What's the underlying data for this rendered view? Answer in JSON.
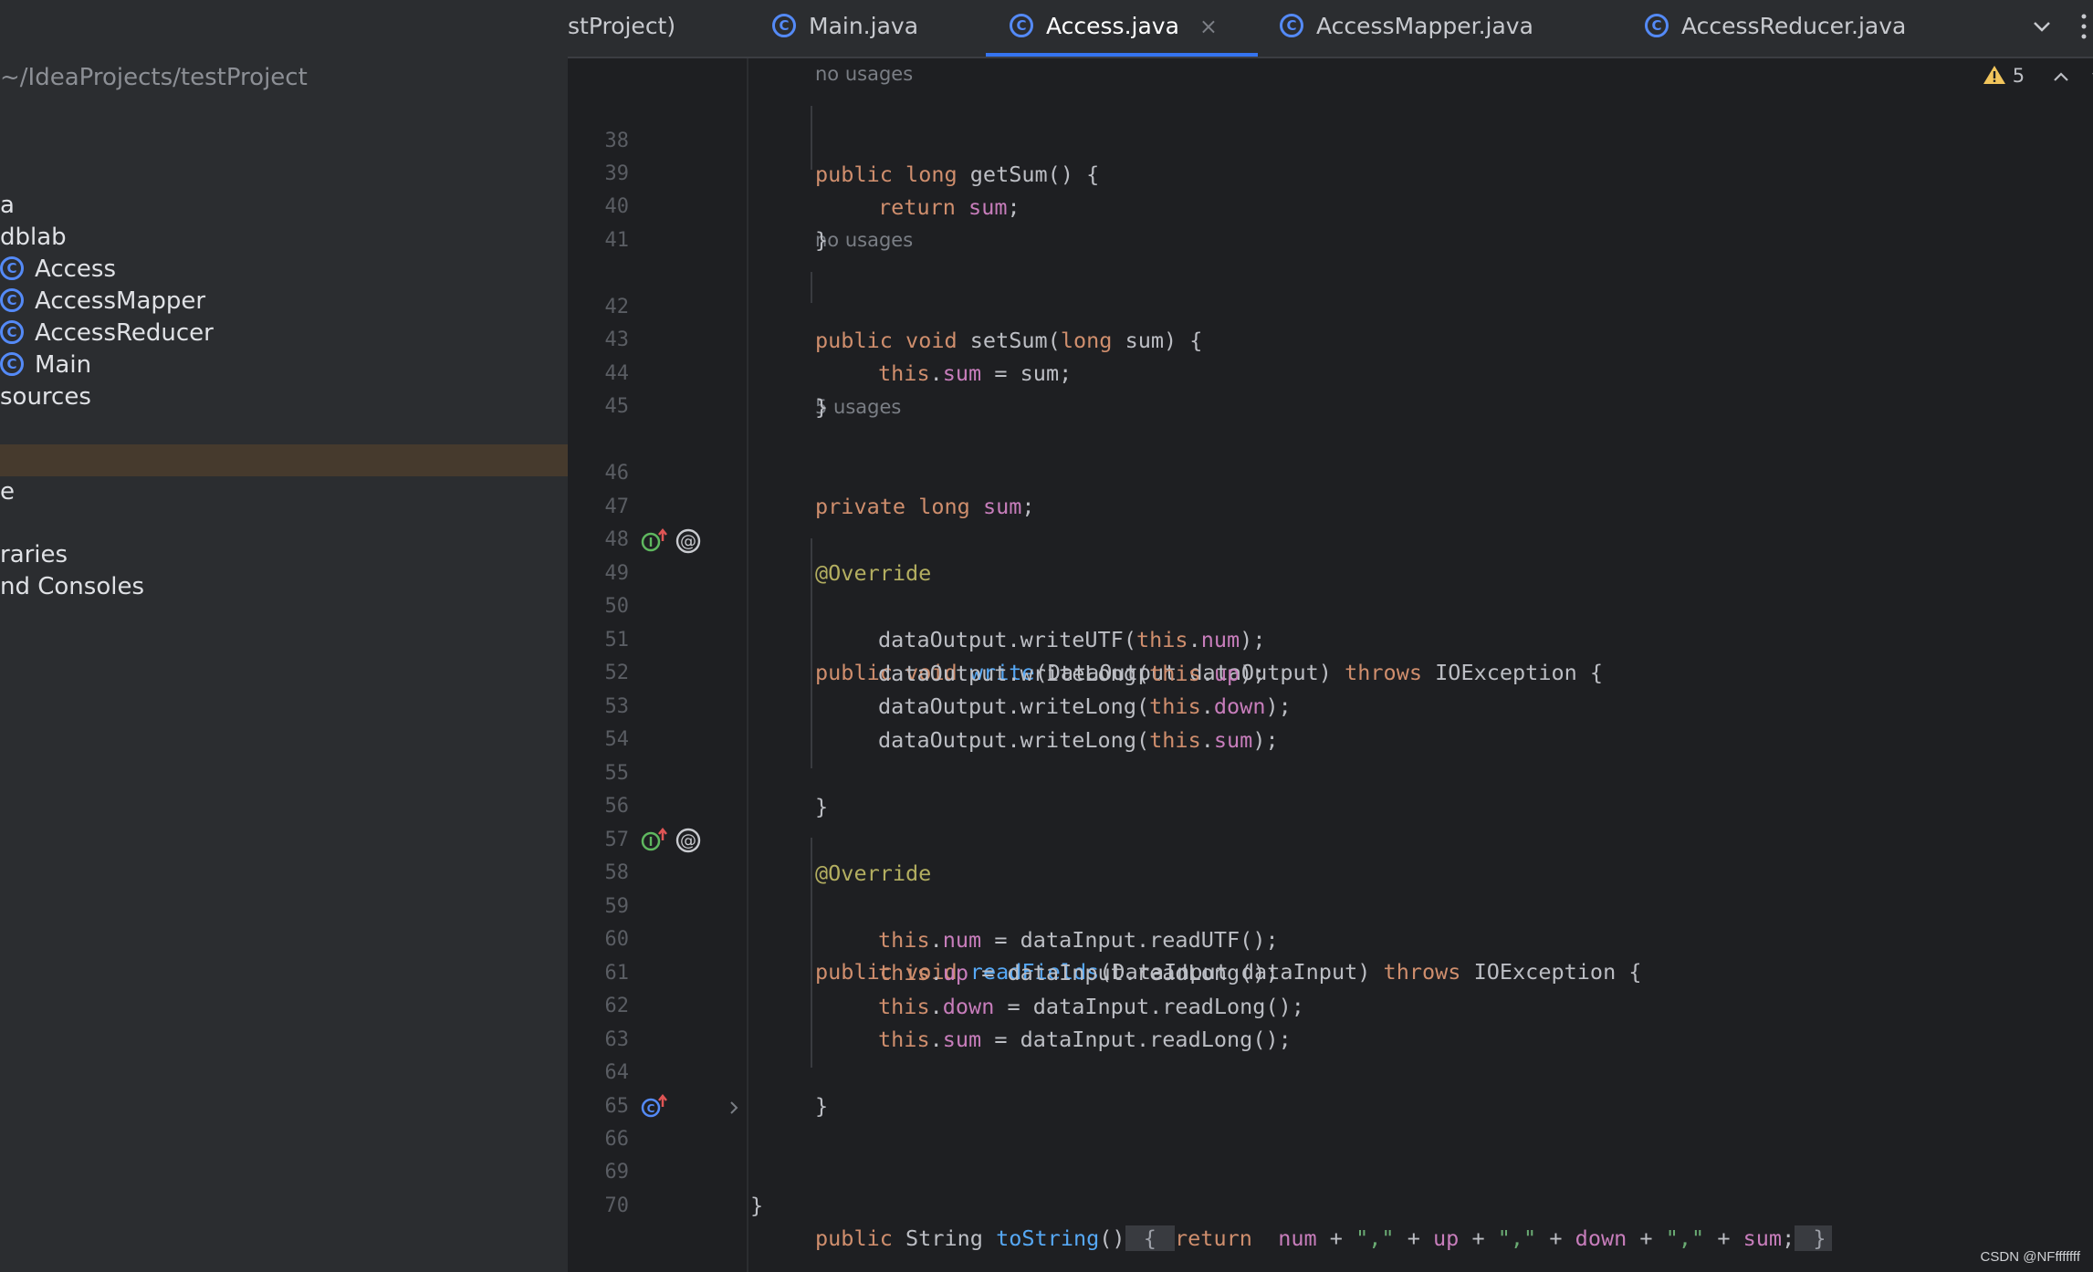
{
  "sidebar": {
    "project_path": "~/IdeaProjects/testProject",
    "items": [
      {
        "label": "a",
        "icon": ""
      },
      {
        "label": "dblab",
        "icon": ""
      },
      {
        "label": "Access",
        "icon": "class-icon"
      },
      {
        "label": "AccessMapper",
        "icon": "class-icon"
      },
      {
        "label": "AccessReducer",
        "icon": "class-icon"
      },
      {
        "label": "Main",
        "icon": "class-icon"
      },
      {
        "label": "sources",
        "icon": ""
      },
      {
        "label": "e",
        "icon": ""
      },
      {
        "label": "raries",
        "icon": ""
      },
      {
        "label": "nd Consoles",
        "icon": ""
      }
    ],
    "class_icon_glyph": "C"
  },
  "tabs": {
    "items": [
      {
        "label": "stProject)"
      },
      {
        "label": "Main.java"
      },
      {
        "label": "Access.java",
        "active": true
      },
      {
        "label": "AccessMapper.java"
      },
      {
        "label": "AccessReducer.java"
      }
    ],
    "close_glyph": "×"
  },
  "editor": {
    "warnings_count": "5",
    "hints": {
      "h38": "no usages",
      "h42": "no usages",
      "h46": "5 usages"
    },
    "line_numbers": {
      "l38": "38",
      "l39": "39",
      "l40": "40",
      "l41": "41",
      "l42": "42",
      "l43": "43",
      "l44": "44",
      "l45": "45",
      "l46": "46",
      "l47": "47",
      "l48": "48",
      "l49": "49",
      "l50": "50",
      "l51": "51",
      "l52": "52",
      "l53": "53",
      "l54": "54",
      "l55": "55",
      "l56": "56",
      "l57": "57",
      "l58": "58",
      "l59": "59",
      "l60": "60",
      "l61": "61",
      "l62": "62",
      "l63": "63",
      "l64": "64",
      "l65": "65",
      "l66": "66",
      "l69": "69",
      "l70": "70"
    },
    "code": {
      "c38": [
        "public",
        " ",
        "long",
        " getSum() {"
      ],
      "c39": [
        "return",
        " ",
        "sum",
        ";"
      ],
      "c40": "}",
      "c42": [
        "public",
        " ",
        "void",
        " setSum(",
        "long",
        " sum) {"
      ],
      "c43": [
        "this",
        ".",
        "sum",
        " = sum;"
      ],
      "c44": "}",
      "c46": [
        "private",
        " ",
        "long",
        " ",
        "sum",
        ";"
      ],
      "c48": "@Override",
      "c49": [
        "public",
        " ",
        "void",
        " ",
        "write",
        "(DataOutput dataOutput) ",
        "throws",
        " IOException {"
      ],
      "c50": [
        "dataOutput.writeUTF(",
        "this",
        ".",
        "num",
        ");"
      ],
      "c51": [
        "dataOutput.writeLong(",
        "this",
        ".",
        "up",
        ");"
      ],
      "c52": [
        "dataOutput.writeLong(",
        "this",
        ".",
        "down",
        ");"
      ],
      "c53": [
        "dataOutput.writeLong(",
        "this",
        ".",
        "sum",
        ");"
      ],
      "c55": "}",
      "c57": "@Override",
      "c58": [
        "public",
        " ",
        "void",
        " ",
        "readFields",
        "(DataInput dataInput) ",
        "throws",
        " IOException {"
      ],
      "c59": [
        "this",
        ".",
        "num",
        " = dataInput.readUTF();"
      ],
      "c60": [
        "this",
        ".",
        "up",
        " = dataInput.readLong();"
      ],
      "c61": [
        "this",
        ".",
        "down",
        " = dataInput.readLong();"
      ],
      "c62": [
        "this",
        ".",
        "sum",
        " = dataInput.readLong();"
      ],
      "c64": "}",
      "c66": [
        "public",
        " String ",
        "toString",
        "()",
        " { ",
        "return",
        "  ",
        "num",
        " + ",
        "\",\"",
        " + ",
        "up",
        " + ",
        "\",\"",
        " + ",
        "down",
        " + ",
        "\",\"",
        " + ",
        "sum",
        ";",
        " }"
      ],
      "c69": "}"
    }
  },
  "watermark": "CSDN @NFfffffff",
  "colors": {
    "keyword": "#cf8e6d",
    "field": "#c77dbb",
    "function": "#56a8f5",
    "annotation": "#b3ae60",
    "string": "#6aab73",
    "accent": "#3574f0"
  }
}
